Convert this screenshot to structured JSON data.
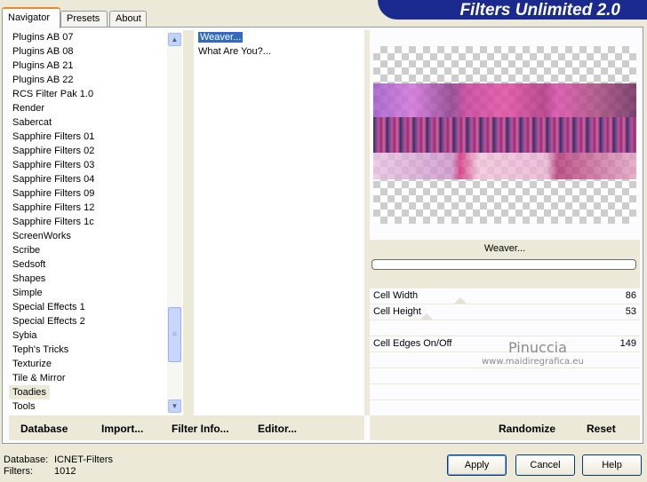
{
  "tabs": [
    "Navigator",
    "Presets",
    "About"
  ],
  "banner_title": "Filters Unlimited 2.0",
  "categories": [
    "Plugins AB 07",
    "Plugins AB 08",
    "Plugins AB 21",
    "Plugins AB 22",
    "RCS Filter Pak 1.0",
    "Render",
    "Sabercat",
    "Sapphire Filters 01",
    "Sapphire Filters 02",
    "Sapphire Filters 03",
    "Sapphire Filters 04",
    "Sapphire Filters 09",
    "Sapphire Filters 12",
    "Sapphire Filters 1c",
    "ScreenWorks",
    "Scribe",
    "Sedsoft",
    "Shapes",
    "Simple",
    "Special Effects 1",
    "Special Effects 2",
    "Sybia",
    "Teph's Tricks",
    "Texturize",
    "Tile & Mirror",
    "Toadies",
    "Tools"
  ],
  "selected_category": "Toadies",
  "filters": [
    "Weaver...",
    "What Are You?..."
  ],
  "selected_filter": "Weaver...",
  "filter_name": "Weaver...",
  "sliders": {
    "cell_width": {
      "label": "Cell Width",
      "value": "86"
    },
    "cell_height": {
      "label": "Cell Height",
      "value": "53"
    },
    "cell_edges": {
      "label": "Cell Edges On/Off",
      "value": "149"
    }
  },
  "watermark": {
    "name": "Pinuccia",
    "url": "www.maidiregrafica.eu"
  },
  "left_actions": {
    "database": "Database",
    "import": "Import...",
    "filter_info": "Filter Info...",
    "editor": "Editor..."
  },
  "right_actions": {
    "randomize": "Randomize",
    "reset": "Reset"
  },
  "status": {
    "database_label": "Database:",
    "database_value": "ICNET-Filters",
    "filters_label": "Filters:",
    "filters_value": "1012"
  },
  "buttons": {
    "apply": "Apply",
    "cancel": "Cancel",
    "help": "Help"
  }
}
